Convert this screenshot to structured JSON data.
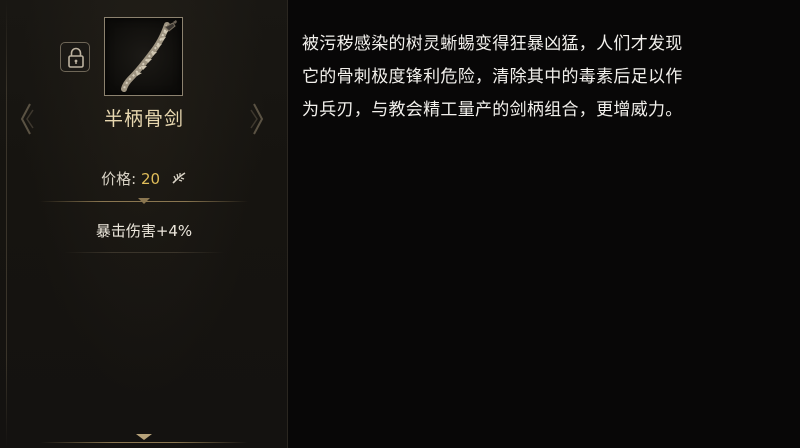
{
  "item": {
    "name": "半柄骨剑",
    "icon": "bone-sword-icon",
    "locked_icon": "lock-icon"
  },
  "price": {
    "label": "价格:",
    "value": "20",
    "currency_icon": "feather-currency-icon"
  },
  "stats": [
    {
      "text": "暴击伤害+4%"
    }
  ],
  "description": {
    "lines": [
      "被污秽感染的树灵蜥蜴变得狂暴凶猛，人们才发现",
      "它的骨刺极度锋利危险，清除其中的毒素后足以作",
      "为兵刃，与教会精工量产的剑柄组合，更增威力。"
    ]
  },
  "colors": {
    "name": "#e8d8b0",
    "price_value": "#e0bd5a",
    "accent_line": "#8a7650",
    "panel_bg": "#171512",
    "text": "#f2f0ec"
  }
}
